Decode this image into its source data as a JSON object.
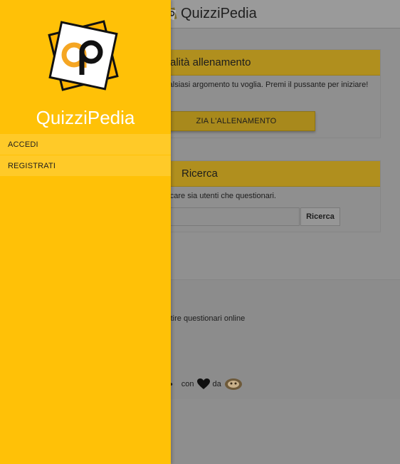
{
  "app": {
    "title": "QuizziPedia"
  },
  "drawer": {
    "title": "QuizziPedia",
    "items": [
      {
        "label": "ACCEDI"
      },
      {
        "label": "REGISTRATI"
      }
    ]
  },
  "training": {
    "header": "alità allenamento",
    "text": "rcitarti su qualsiasi argomento tu voglia. Premi il pussante per iniziare!",
    "button_label": "ZIA L'ALLENAMENTO"
  },
  "search": {
    "header": "Ricerca",
    "text": "ercare sia utenti che questionari.",
    "input_value": "",
    "button_label": "Ricerca"
  },
  "footer": {
    "description": "estire questionari online",
    "credit_code": ">",
    "credit_with": "con",
    "credit_by": "da"
  },
  "colors": {
    "drawer_bg": "#ffc107",
    "drawer_item_bg": "#ffca28",
    "overlay": "#8e8e8e",
    "accent_dim": "#b08f1e"
  },
  "icons": {
    "logo": "quizzipedia-logo-icon",
    "heart": "heart-icon",
    "author": "author-avatar-icon"
  }
}
